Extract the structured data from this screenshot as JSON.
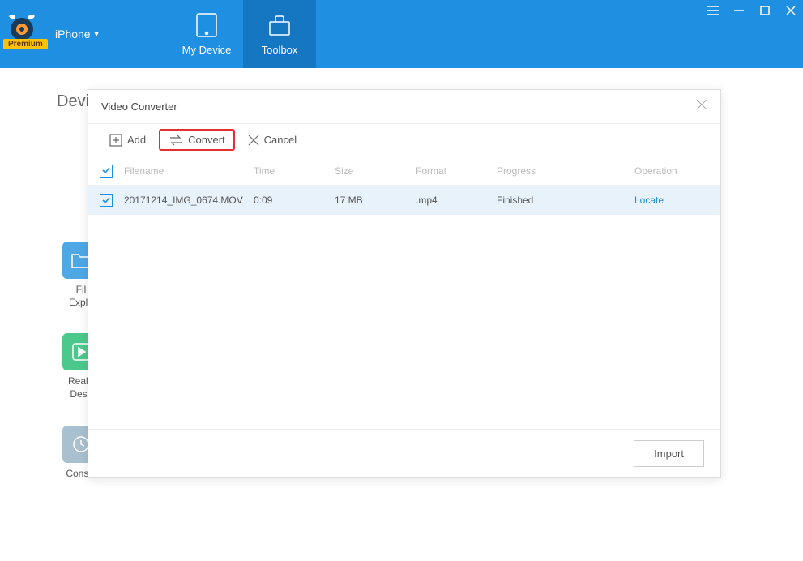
{
  "header": {
    "device_selector": "iPhone",
    "premium_badge": "Premium",
    "tabs": [
      {
        "label": "My Device"
      },
      {
        "label": "Toolbox"
      }
    ]
  },
  "main": {
    "title_fragment": "Devi",
    "side_tools": [
      {
        "label_line1": "Fil",
        "label_line2": "Explo"
      },
      {
        "label_line1": "Real-t",
        "label_line2": "Desk"
      },
      {
        "label_line1": "Consol",
        "label_line2": ""
      }
    ]
  },
  "modal": {
    "title": "Video Converter",
    "toolbar": {
      "add": "Add",
      "convert": "Convert",
      "cancel": "Cancel"
    },
    "columns": {
      "filename": "Filename",
      "time": "Time",
      "size": "Size",
      "format": "Format",
      "progress": "Progress",
      "operation": "Operation"
    },
    "rows": [
      {
        "filename": "20171214_IMG_0674.MOV",
        "time": "0:09",
        "size": "17 MB",
        "format": ".mp4",
        "progress": "Finished",
        "operation": "Locate"
      }
    ],
    "footer": {
      "import": "Import"
    }
  }
}
